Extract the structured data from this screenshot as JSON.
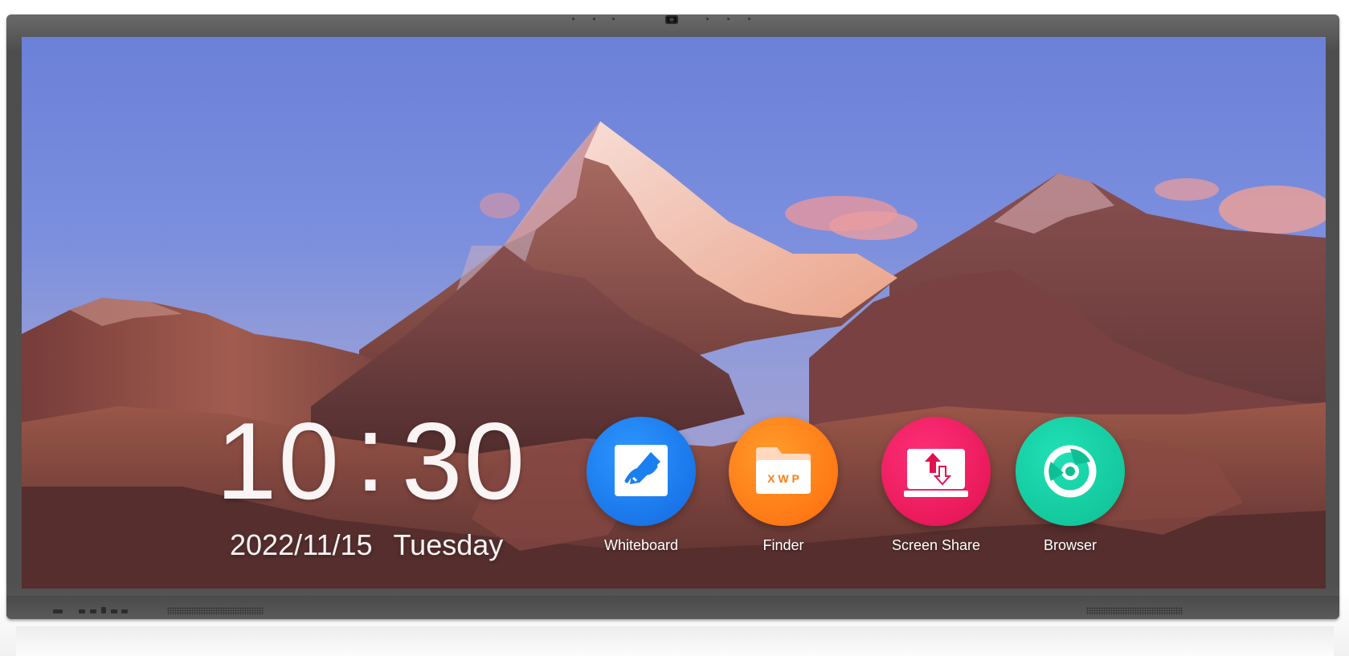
{
  "home_screen": {
    "clock": {
      "hours": "10",
      "separator": ":",
      "minutes": "30"
    },
    "date": "2022/11/15",
    "weekday": "Tuesday",
    "apps": [
      {
        "label": "Whiteboard",
        "icon": "whiteboard-pen-icon",
        "color": "#1a7ff0"
      },
      {
        "label": "Finder",
        "icon": "folder-icon",
        "color": "#ff7d12",
        "icon_text": "X W P"
      },
      {
        "label": "Screen Share",
        "icon": "screen-share-icon",
        "color": "#f0185f"
      },
      {
        "label": "Browser",
        "icon": "browser-icon",
        "color": "#14d1a4"
      }
    ]
  }
}
